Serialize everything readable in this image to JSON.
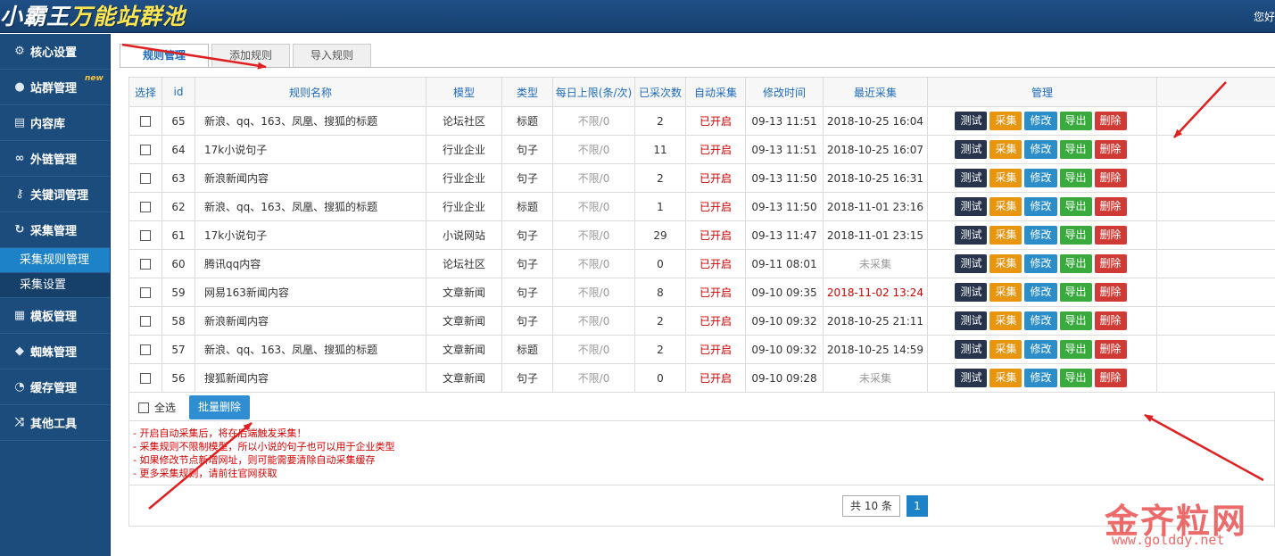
{
  "header": {
    "logo_main": "小霸王",
    "logo_accent": "万能站群池",
    "user_text": "您好"
  },
  "sidebar": {
    "items": [
      {
        "label": "核心设置",
        "icon": "gear-icon"
      },
      {
        "label": "站群管理",
        "icon": "user-icon",
        "badge": "new"
      },
      {
        "label": "内容库",
        "icon": "document-icon"
      },
      {
        "label": "外链管理",
        "icon": "link-icon"
      },
      {
        "label": "关键词管理",
        "icon": "key-icon"
      },
      {
        "label": "采集管理",
        "icon": "refresh-icon"
      },
      {
        "label": "采集规则管理",
        "sub": true,
        "active": true
      },
      {
        "label": "采集设置",
        "sub": true
      },
      {
        "label": "模板管理",
        "icon": "windows-icon"
      },
      {
        "label": "蜘蛛管理",
        "icon": "android-icon"
      },
      {
        "label": "缓存管理",
        "icon": "dashboard-icon"
      },
      {
        "label": "其他工具",
        "icon": "shuffle-icon"
      }
    ]
  },
  "tabs": [
    {
      "label": "规则管理",
      "active": true
    },
    {
      "label": "添加规则"
    },
    {
      "label": "导入规则"
    }
  ],
  "table": {
    "headers": [
      "选择",
      "id",
      "规则名称",
      "模型",
      "类型",
      "每日上限(条/次)",
      "已采次数",
      "自动采集",
      "修改时间",
      "最近采集",
      "管理"
    ],
    "rows": [
      {
        "id": "65",
        "name": "新浪、qq、163、凤凰、搜狐的标题",
        "model": "论坛社区",
        "type": "标题",
        "limit": "不限/0",
        "count": "2",
        "auto": "已开启",
        "mtime": "09-13 11:51",
        "last": "2018-10-25 16:04",
        "last_style": "normal"
      },
      {
        "id": "64",
        "name": "17k小说句子",
        "model": "行业企业",
        "type": "句子",
        "limit": "不限/0",
        "count": "11",
        "auto": "已开启",
        "mtime": "09-13 11:51",
        "last": "2018-10-25 16:07",
        "last_style": "normal"
      },
      {
        "id": "63",
        "name": "新浪新闻内容",
        "model": "行业企业",
        "type": "句子",
        "limit": "不限/0",
        "count": "2",
        "auto": "已开启",
        "mtime": "09-13 11:50",
        "last": "2018-10-25 16:31",
        "last_style": "normal"
      },
      {
        "id": "62",
        "name": "新浪、qq、163、凤凰、搜狐的标题",
        "model": "行业企业",
        "type": "标题",
        "limit": "不限/0",
        "count": "1",
        "auto": "已开启",
        "mtime": "09-13 11:50",
        "last": "2018-11-01 23:16",
        "last_style": "normal"
      },
      {
        "id": "61",
        "name": "17k小说句子",
        "model": "小说网站",
        "type": "句子",
        "limit": "不限/0",
        "count": "29",
        "auto": "已开启",
        "mtime": "09-13 11:47",
        "last": "2018-11-01 23:15",
        "last_style": "normal"
      },
      {
        "id": "60",
        "name": "腾讯qq内容",
        "model": "论坛社区",
        "type": "句子",
        "limit": "不限/0",
        "count": "0",
        "auto": "已开启",
        "mtime": "09-11 08:01",
        "last": "未采集",
        "last_style": "gray"
      },
      {
        "id": "59",
        "name": "网易163新闻内容",
        "model": "文章新闻",
        "type": "句子",
        "limit": "不限/0",
        "count": "8",
        "auto": "已开启",
        "mtime": "09-10 09:35",
        "last": "2018-11-02 13:24",
        "last_style": "red"
      },
      {
        "id": "58",
        "name": "新浪新闻内容",
        "model": "文章新闻",
        "type": "句子",
        "limit": "不限/0",
        "count": "2",
        "auto": "已开启",
        "mtime": "09-10 09:32",
        "last": "2018-10-25 21:11",
        "last_style": "normal"
      },
      {
        "id": "57",
        "name": "新浪、qq、163、凤凰、搜狐的标题",
        "model": "文章新闻",
        "type": "标题",
        "limit": "不限/0",
        "count": "2",
        "auto": "已开启",
        "mtime": "09-10 09:32",
        "last": "2018-10-25 14:59",
        "last_style": "normal"
      },
      {
        "id": "56",
        "name": "搜狐新闻内容",
        "model": "文章新闻",
        "type": "句子",
        "limit": "不限/0",
        "count": "0",
        "auto": "已开启",
        "mtime": "09-10 09:28",
        "last": "未采集",
        "last_style": "gray"
      }
    ],
    "actions": [
      "测试",
      "采集",
      "修改",
      "导出",
      "删除"
    ]
  },
  "footer": {
    "select_all": "全选",
    "bulk_delete": "批量删除",
    "notes": [
      "- 开启自动采集后，将在后端触发采集！",
      "- 采集规则不限制模型，所以小说的句子也可以用于企业类型",
      "- 如果修改节点新增网址，则可能需要清除自动采集缓存",
      "- 更多采集规则，请前往官网获取"
    ]
  },
  "pagination": {
    "total": "共 10 条",
    "current_page": "1"
  },
  "watermark": {
    "cn": "金齐粒网",
    "url": "www.golddy.net"
  },
  "colors": {
    "header_bg": "#1f4f86",
    "sidebar_bg": "#1b4c7b",
    "active_sub": "#1e82c8",
    "enabled_red": "#d20000",
    "btn_test": "#28344c",
    "btn_collect": "#e8950f",
    "btn_edit": "#2b8ec9",
    "btn_export": "#3aa93e",
    "btn_delete": "#d03a35",
    "annotation_arrow": "#e02020"
  }
}
